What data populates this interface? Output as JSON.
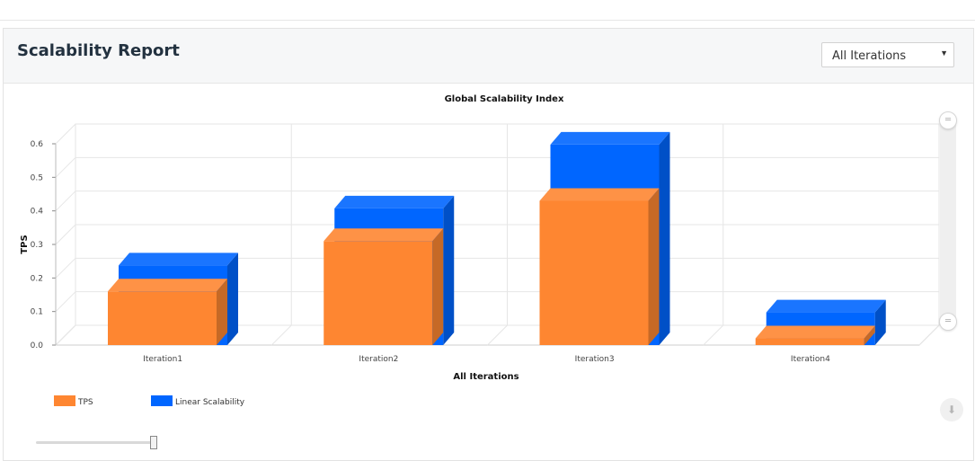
{
  "header": {
    "title": "Scalability Report",
    "select": {
      "value": "All Iterations"
    }
  },
  "colors": {
    "tps": "#fe8631",
    "linear": "#0066ff"
  },
  "chart_data": {
    "type": "bar",
    "title": "Global Scalability Index",
    "xlabel": "All Iterations",
    "ylabel": "TPS",
    "categories": [
      "Iteration1",
      "Iteration2",
      "Iteration3",
      "Iteration4"
    ],
    "series": [
      {
        "name": "TPS",
        "values": [
          0.16,
          0.31,
          0.43,
          0.02
        ]
      },
      {
        "name": "Linear Scalability",
        "values": [
          0.2,
          0.37,
          0.56,
          0.06
        ]
      }
    ],
    "ylim": [
      0,
      0.6
    ],
    "yticks": [
      "0.0",
      "0.1",
      "0.2",
      "0.3",
      "0.4",
      "0.5",
      "0.6"
    ],
    "grid": true,
    "legend": "bottom-left"
  }
}
